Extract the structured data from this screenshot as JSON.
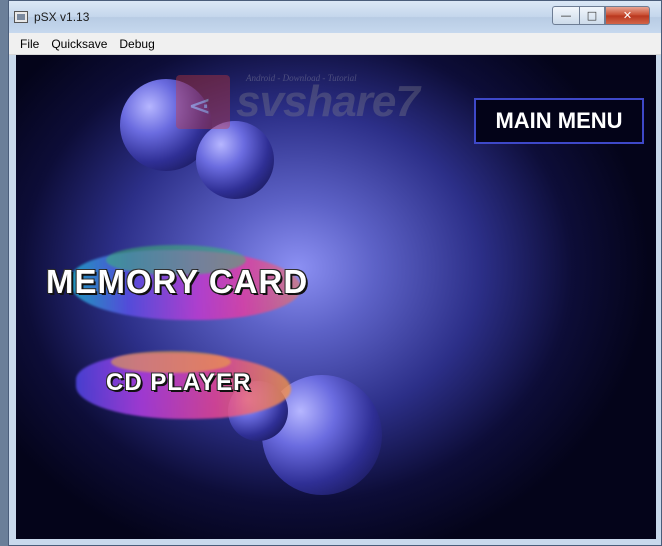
{
  "window": {
    "title": "pSX v1.13",
    "minimize_label": "—",
    "maximize_label": "□",
    "close_label": "✕"
  },
  "menubar": {
    "items": [
      "File",
      "Quicksave",
      "Debug"
    ]
  },
  "watermark": {
    "brand": "svshare7",
    "tagline": "Android - Download - Tutorial"
  },
  "screen": {
    "main_menu_label": "MAIN MENU",
    "options": [
      "MEMORY CARD",
      "CD PLAYER"
    ]
  },
  "colors": {
    "background_center": "#8c90f3",
    "background_edge": "#04041a",
    "main_menu_border": "#3e48c8",
    "close_button": "#c7492c"
  }
}
